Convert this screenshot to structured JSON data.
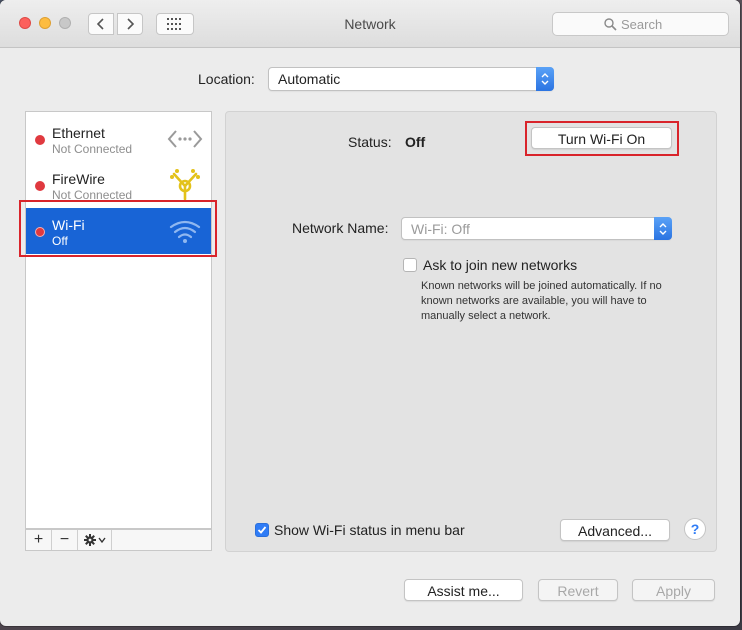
{
  "window": {
    "title": "Network"
  },
  "toolbar": {
    "back_icon": "chevron-left-icon",
    "forward_icon": "chevron-right-icon",
    "show_all_icon": "grid-icon",
    "search_placeholder": "Search"
  },
  "location": {
    "label": "Location:",
    "value": "Automatic"
  },
  "services": [
    {
      "name": "Ethernet",
      "status": "Not Connected",
      "status_color": "#e0393f",
      "icon": "ethernet-icon",
      "selected": false
    },
    {
      "name": "FireWire",
      "status": "Not Connected",
      "status_color": "#e0393f",
      "icon": "firewire-icon",
      "selected": false
    },
    {
      "name": "Wi-Fi",
      "status": "Off",
      "status_color": "#e0393f",
      "icon": "wifi-icon",
      "selected": true
    }
  ],
  "sidebar_actions": {
    "add": "+",
    "remove": "−",
    "gear_icon": "gear-icon"
  },
  "detail": {
    "status_label": "Status:",
    "status_value": "Off",
    "turn_on_button": "Turn Wi-Fi On",
    "network_name_label": "Network Name:",
    "network_name_value": "Wi-Fi: Off",
    "ask_join_label": "Ask to join new networks",
    "ask_join_checked": false,
    "ask_join_desc": "Known networks will be joined automatically. If no known networks are available, you will have to manually select a network.",
    "show_status_label": "Show Wi-Fi status in menu bar",
    "show_status_checked": true,
    "advanced_button": "Advanced...",
    "help_button": "?"
  },
  "footer": {
    "assist_button": "Assist me...",
    "revert_button": "Revert",
    "apply_button": "Apply"
  },
  "colors": {
    "accent": "#1864d6",
    "highlight": "#d9242b",
    "status_off": "#e0393f"
  }
}
